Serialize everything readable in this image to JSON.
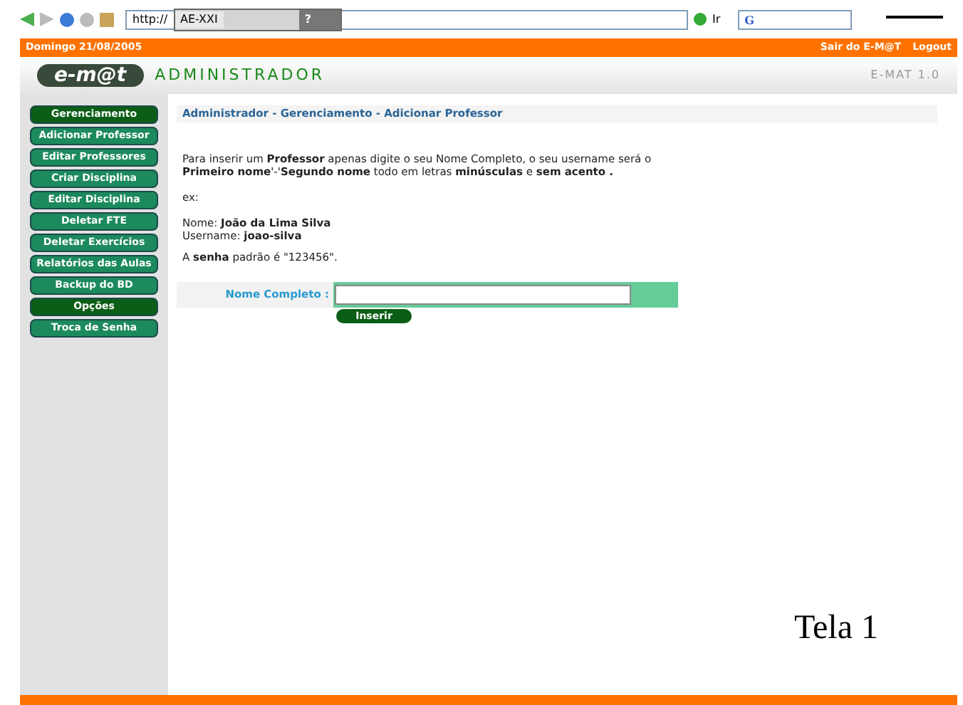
{
  "browser": {
    "address_prefix": "http://",
    "overlay_title": "AE-XXI",
    "overlay_help": "?",
    "go_label": "Ir",
    "search_logo": "G"
  },
  "top_bar": {
    "date": "Domingo 21/08/2005",
    "links": [
      "Sair do E-M@T",
      "Logout"
    ]
  },
  "header": {
    "logo": "e-m@t",
    "title": "ADMINISTRADOR",
    "version": "E-MAT 1.0"
  },
  "sidebar": {
    "items": [
      {
        "label": "Gerenciamento",
        "kind": "section"
      },
      {
        "label": "Adicionar Professor",
        "kind": "link"
      },
      {
        "label": "Editar Professores",
        "kind": "link"
      },
      {
        "label": "Criar Disciplina",
        "kind": "link"
      },
      {
        "label": "Editar Disciplina",
        "kind": "link"
      },
      {
        "label": "Deletar FTE",
        "kind": "link"
      },
      {
        "label": "Deletar Exercícios",
        "kind": "link"
      },
      {
        "label": "Relatórios das Aulas",
        "kind": "link"
      },
      {
        "label": "Backup do BD",
        "kind": "link"
      },
      {
        "label": "Opções",
        "kind": "section"
      },
      {
        "label": "Troca de Senha",
        "kind": "link"
      }
    ]
  },
  "content": {
    "breadcrumb": "Administrador - Gerenciamento - Adicionar Professor",
    "intro": "Para inserir um **Professor** apenas digite o seu Nome Completo, o seu username será o **Primeiro nome**'-'**Segundo nome** todo em letras **minúsculas** e **sem acento .**",
    "example_label": "ex:",
    "example_lines": [
      "Nome: **João da Lima Silva**",
      "Username: **joao-silva**"
    ],
    "password_note": "A **senha** padrão é \"123456\".",
    "form": {
      "label": "Nome Completo :",
      "button": "Inserir"
    }
  },
  "caption": "Tela 1"
}
